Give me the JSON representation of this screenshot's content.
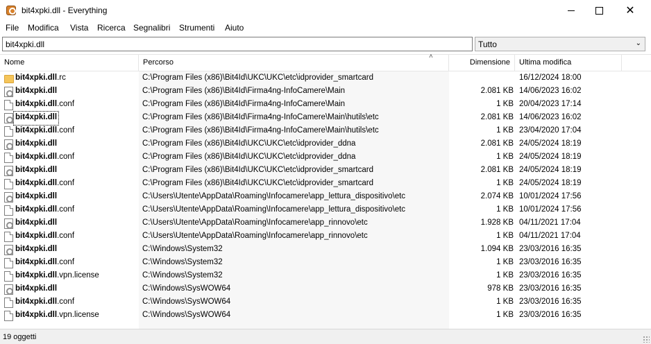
{
  "window": {
    "title": "bit4xpki.dll - Everything",
    "app_icon": "everything-app-icon"
  },
  "menu": [
    "File",
    "Modifica",
    "Vista",
    "Ricerca",
    "Segnalibri",
    "Strumenti",
    "Aiuto"
  ],
  "search": {
    "value": "bit4xpki.dll"
  },
  "filter": {
    "selected": "Tutto"
  },
  "columns": {
    "name": "Nome",
    "path": "Percorso",
    "size": "Dimensione",
    "modified": "Ultima modifica"
  },
  "rows": [
    {
      "base": "bit4xpki.dll",
      "ext": ".rc",
      "icon": "folder-icon",
      "path": "C:\\Program Files (x86)\\Bit4Id\\UKC\\UKC\\etc\\idprovider_smartcard",
      "size": "",
      "date": "16/12/2024 18:00"
    },
    {
      "base": "bit4xpki.dll",
      "ext": "",
      "icon": "dll-icon",
      "path": "C:\\Program Files (x86)\\Bit4Id\\Firma4ng-InfoCamere\\Main",
      "size": "2.081 KB",
      "date": "14/06/2023 16:02"
    },
    {
      "base": "bit4xpki.dll",
      "ext": ".conf",
      "icon": "file-icon",
      "path": "C:\\Program Files (x86)\\Bit4Id\\Firma4ng-InfoCamere\\Main",
      "size": "1 KB",
      "date": "20/04/2023 17:14"
    },
    {
      "base": "bit4xpki.dll",
      "ext": "",
      "icon": "dll-icon",
      "path": "C:\\Program Files (x86)\\Bit4Id\\Firma4ng-InfoCamere\\Main\\hutils\\etc",
      "size": "2.081 KB",
      "date": "14/06/2023 16:02",
      "focused": true
    },
    {
      "base": "bit4xpki.dll",
      "ext": ".conf",
      "icon": "file-icon",
      "path": "C:\\Program Files (x86)\\Bit4Id\\Firma4ng-InfoCamere\\Main\\hutils\\etc",
      "size": "1 KB",
      "date": "23/04/2020 17:04"
    },
    {
      "base": "bit4xpki.dll",
      "ext": "",
      "icon": "dll-icon",
      "path": "C:\\Program Files (x86)\\Bit4Id\\UKC\\UKC\\etc\\idprovider_ddna",
      "size": "2.081 KB",
      "date": "24/05/2024 18:19"
    },
    {
      "base": "bit4xpki.dll",
      "ext": ".conf",
      "icon": "file-icon",
      "path": "C:\\Program Files (x86)\\Bit4Id\\UKC\\UKC\\etc\\idprovider_ddna",
      "size": "1 KB",
      "date": "24/05/2024 18:19"
    },
    {
      "base": "bit4xpki.dll",
      "ext": "",
      "icon": "dll-icon",
      "path": "C:\\Program Files (x86)\\Bit4Id\\UKC\\UKC\\etc\\idprovider_smartcard",
      "size": "2.081 KB",
      "date": "24/05/2024 18:19"
    },
    {
      "base": "bit4xpki.dll",
      "ext": ".conf",
      "icon": "file-icon",
      "path": "C:\\Program Files (x86)\\Bit4Id\\UKC\\UKC\\etc\\idprovider_smartcard",
      "size": "1 KB",
      "date": "24/05/2024 18:19"
    },
    {
      "base": "bit4xpki.dll",
      "ext": "",
      "icon": "dll-icon",
      "path": "C:\\Users\\Utente\\AppData\\Roaming\\Infocamere\\app_lettura_dispositivo\\etc",
      "size": "2.074 KB",
      "date": "10/01/2024 17:56"
    },
    {
      "base": "bit4xpki.dll",
      "ext": ".conf",
      "icon": "file-icon",
      "path": "C:\\Users\\Utente\\AppData\\Roaming\\Infocamere\\app_lettura_dispositivo\\etc",
      "size": "1 KB",
      "date": "10/01/2024 17:56"
    },
    {
      "base": "bit4xpki.dll",
      "ext": "",
      "icon": "dll-icon",
      "path": "C:\\Users\\Utente\\AppData\\Roaming\\Infocamere\\app_rinnovo\\etc",
      "size": "1.928 KB",
      "date": "04/11/2021 17:04"
    },
    {
      "base": "bit4xpki.dll",
      "ext": ".conf",
      "icon": "file-icon",
      "path": "C:\\Users\\Utente\\AppData\\Roaming\\Infocamere\\app_rinnovo\\etc",
      "size": "1 KB",
      "date": "04/11/2021 17:04"
    },
    {
      "base": "bit4xpki.dll",
      "ext": "",
      "icon": "dll-icon",
      "path": "C:\\Windows\\System32",
      "size": "1.094 KB",
      "date": "23/03/2016 16:35"
    },
    {
      "base": "bit4xpki.dll",
      "ext": ".conf",
      "icon": "file-icon",
      "path": "C:\\Windows\\System32",
      "size": "1 KB",
      "date": "23/03/2016 16:35"
    },
    {
      "base": "bit4xpki.dll",
      "ext": ".vpn.license",
      "icon": "file-icon",
      "path": "C:\\Windows\\System32",
      "size": "1 KB",
      "date": "23/03/2016 16:35"
    },
    {
      "base": "bit4xpki.dll",
      "ext": "",
      "icon": "dll-icon",
      "path": "C:\\Windows\\SysWOW64",
      "size": "978 KB",
      "date": "23/03/2016 16:35"
    },
    {
      "base": "bit4xpki.dll",
      "ext": ".conf",
      "icon": "file-icon",
      "path": "C:\\Windows\\SysWOW64",
      "size": "1 KB",
      "date": "23/03/2016 16:35"
    },
    {
      "base": "bit4xpki.dll",
      "ext": ".vpn.license",
      "icon": "file-icon",
      "path": "C:\\Windows\\SysWOW64",
      "size": "1 KB",
      "date": "23/03/2016 16:35"
    }
  ],
  "status": {
    "text": "19 oggetti"
  }
}
